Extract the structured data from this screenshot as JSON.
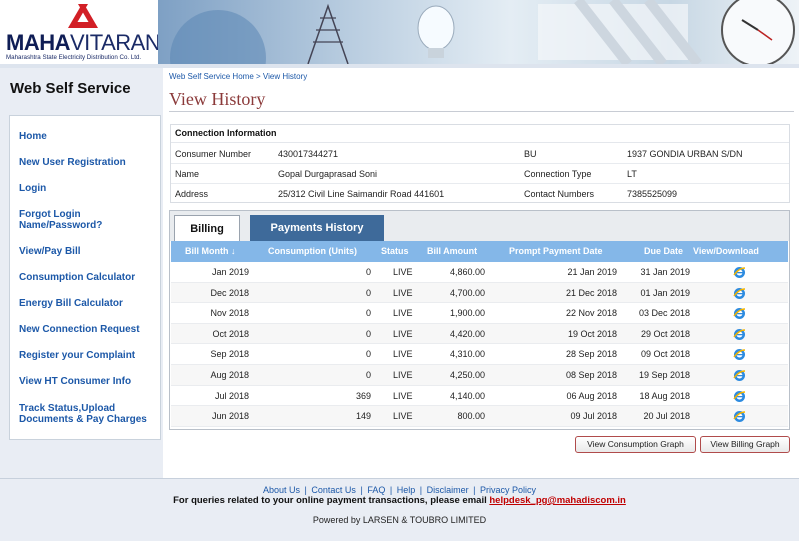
{
  "header": {
    "brand_bold": "MAHA",
    "brand_light": "VITARAN",
    "tagline": "Maharashtra State Electricity Distribution Co. Ltd."
  },
  "sidebar": {
    "title": "Web Self Service",
    "items": [
      {
        "label": "Home"
      },
      {
        "label": "New User Registration"
      },
      {
        "label": "Login"
      },
      {
        "label": "Forgot Login Name/Password?"
      },
      {
        "label": "View/Pay Bill"
      },
      {
        "label": "Consumption Calculator"
      },
      {
        "label": "Energy Bill Calculator"
      },
      {
        "label": "New Connection Request"
      },
      {
        "label": "Register your Complaint"
      },
      {
        "label": "View HT Consumer Info"
      },
      {
        "label": "Track Status,Upload Documents & Pay Charges"
      }
    ]
  },
  "breadcrumb": {
    "home": "Web Self Service Home",
    "sep": " > ",
    "current": "View History"
  },
  "page_title": "View History",
  "connection": {
    "heading": "Connection Information",
    "consumer_number_label": "Consumer Number",
    "consumer_number": "430017344271",
    "bu_label": "BU",
    "bu": "1937 GONDIA URBAN S/DN",
    "name_label": "Name",
    "name": "Gopal Durgaprasad Soni",
    "connection_type_label": "Connection Type",
    "connection_type": "LT",
    "address_label": "Address",
    "address": "25/312 Civil Line Saimandir Road 441601",
    "contact_label": "Contact Numbers",
    "contact": "7385525099"
  },
  "tabs": {
    "billing": "Billing",
    "payments": "Payments History"
  },
  "table": {
    "headers": {
      "bill_month": "Bill Month",
      "sort_glyph": "↓",
      "consumption": "Consumption (Units)",
      "status": "Status",
      "amount": "Bill Amount",
      "prompt_date": "Prompt Payment Date",
      "due_date": "Due Date",
      "view": "View/Download"
    },
    "rows": [
      {
        "month": "Jan 2019",
        "units": "0",
        "status": "LIVE",
        "amount": "4,860.00",
        "prompt": "21 Jan 2019",
        "due": "31 Jan 2019"
      },
      {
        "month": "Dec 2018",
        "units": "0",
        "status": "LIVE",
        "amount": "4,700.00",
        "prompt": "21 Dec 2018",
        "due": "01 Jan 2019"
      },
      {
        "month": "Nov 2018",
        "units": "0",
        "status": "LIVE",
        "amount": "1,900.00",
        "prompt": "22 Nov 2018",
        "due": "03 Dec 2018"
      },
      {
        "month": "Oct 2018",
        "units": "0",
        "status": "LIVE",
        "amount": "4,420.00",
        "prompt": "19 Oct 2018",
        "due": "29 Oct 2018"
      },
      {
        "month": "Sep 2018",
        "units": "0",
        "status": "LIVE",
        "amount": "4,310.00",
        "prompt": "28 Sep 2018",
        "due": "09 Oct 2018"
      },
      {
        "month": "Aug 2018",
        "units": "0",
        "status": "LIVE",
        "amount": "4,250.00",
        "prompt": "08 Sep 2018",
        "due": "19 Sep 2018"
      },
      {
        "month": "Jul 2018",
        "units": "369",
        "status": "LIVE",
        "amount": "4,140.00",
        "prompt": "06 Aug 2018",
        "due": "18 Aug 2018"
      },
      {
        "month": "Jun 2018",
        "units": "149",
        "status": "LIVE",
        "amount": "800.00",
        "prompt": "09 Jul 2018",
        "due": "20 Jul 2018"
      }
    ]
  },
  "buttons": {
    "consumption_graph": "View Consumption Graph",
    "billing_graph": "View Billing Graph"
  },
  "footer": {
    "links": [
      "About Us",
      "Contact Us",
      "FAQ",
      "Help",
      "Disclaimer",
      "Privacy Policy"
    ],
    "separator": "|",
    "note": "For queries related to your online payment transactions, please email",
    "email": "helpdesk_pg@mahadiscom.in",
    "powered": "Powered by LARSEN & TOUBRO LIMITED"
  },
  "colors": {
    "accent": "#1c58a8",
    "title": "#8b3a3a",
    "table_header": "#84b7e8",
    "tab_active_bg": "#3e6a9a",
    "logo_red": "#d21f26"
  }
}
